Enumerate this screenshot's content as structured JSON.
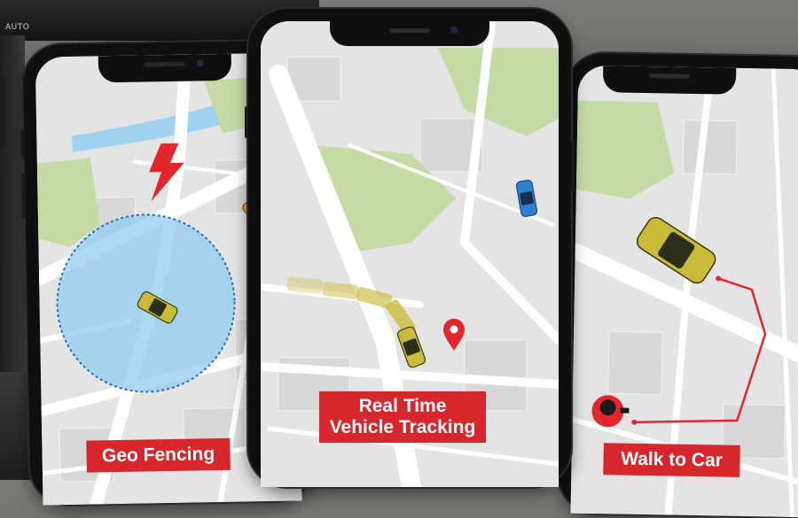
{
  "dashboard": {
    "auto_label": "AUTO"
  },
  "phones": [
    {
      "feature": "geo-fencing",
      "label": "Geo Fencing"
    },
    {
      "feature": "vehicle-tracking",
      "label_line1": "Real Time",
      "label_line2": "Vehicle Tracking"
    },
    {
      "feature": "walk-to-car",
      "label": "Walk to Car"
    }
  ],
  "colors": {
    "label_red": "#d7262c",
    "map_bg": "#e4e4e4",
    "road": "#ffffff",
    "park": "#c4dca4",
    "geofence": "#8fcaf0",
    "car_yellow": "#c9bb3a",
    "car_orange": "#f29a1c",
    "car_blue": "#2f7fd6",
    "route_red": "#e3262b"
  }
}
